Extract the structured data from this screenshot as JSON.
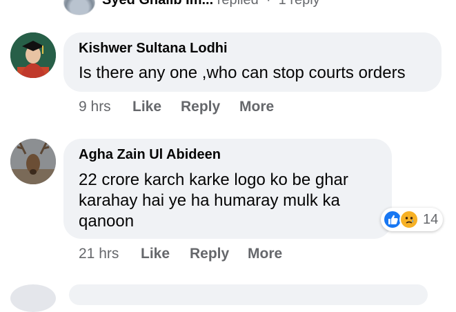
{
  "top_reply": {
    "name": "Syed Ghalib Im...",
    "action": "replied",
    "count": "1 reply"
  },
  "comments": [
    {
      "author": "Kishwer Sultana Lodhi",
      "text": "Is there any one ,who can stop courts orders",
      "time": "9 hrs",
      "actions": [
        "Like",
        "Reply",
        "More"
      ]
    },
    {
      "author": "Agha Zain Ul Abideen",
      "text": "22 crore karch karke logo ko be ghar karahay hai ye ha humaray mulk ka qanoon",
      "time": "21 hrs",
      "actions": [
        "Like",
        "Reply",
        "More"
      ],
      "reactions": {
        "icons": [
          "like-icon",
          "sad-icon"
        ],
        "count": "14"
      }
    }
  ],
  "colors": {
    "bubble": "#f0f2f5",
    "meta": "#65676b",
    "like": "#1877f2",
    "sad": "#f7b125"
  }
}
